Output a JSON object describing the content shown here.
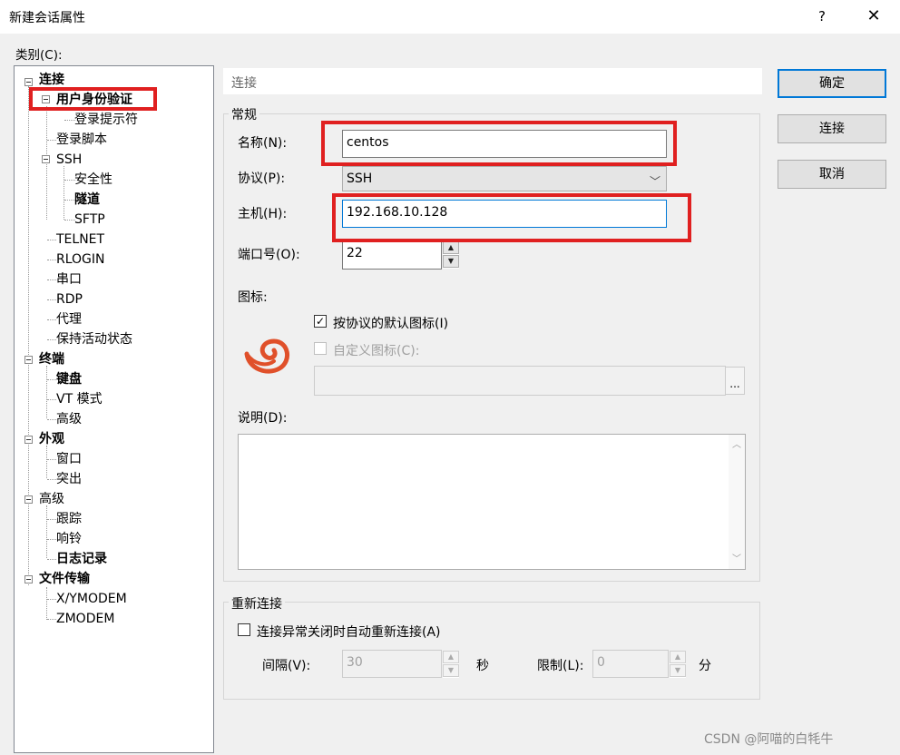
{
  "window": {
    "title": "新建会话属性",
    "help_label": "?",
    "close_label": "✕"
  },
  "category_label": "类别(C):",
  "tree": {
    "nodes": [
      {
        "label": "连接"
      },
      {
        "label": "用户身份验证"
      },
      {
        "label": "登录提示符"
      },
      {
        "label": "登录脚本"
      },
      {
        "label": "SSH"
      },
      {
        "label": "安全性"
      },
      {
        "label": "隧道"
      },
      {
        "label": "SFTP"
      },
      {
        "label": "TELNET"
      },
      {
        "label": "RLOGIN"
      },
      {
        "label": "串口"
      },
      {
        "label": "RDP"
      },
      {
        "label": "代理"
      },
      {
        "label": "保持活动状态"
      },
      {
        "label": "终端"
      },
      {
        "label": "键盘"
      },
      {
        "label": "VT 模式"
      },
      {
        "label": "高级"
      },
      {
        "label": "外观"
      },
      {
        "label": "窗口"
      },
      {
        "label": "突出"
      },
      {
        "label": "高级"
      },
      {
        "label": "跟踪"
      },
      {
        "label": "响铃"
      },
      {
        "label": "日志记录"
      },
      {
        "label": "文件传输"
      },
      {
        "label": "X/YMODEM"
      },
      {
        "label": "ZMODEM"
      }
    ]
  },
  "section_header": "连接",
  "general": {
    "group_title": "常规",
    "name_label": "名称(N):",
    "name_value": "centos",
    "protocol_label": "协议(P):",
    "protocol_value": "SSH",
    "host_label": "主机(H):",
    "host_value": "192.168.10.128",
    "port_label": "端口号(O):",
    "port_value": "22",
    "icon_label": "图标:",
    "default_icon_checkbox": "按协议的默认图标(I)",
    "custom_icon_checkbox": "自定义图标(C):",
    "browse_label": "...",
    "description_label": "说明(D):"
  },
  "reconnect": {
    "group_title": "重新连接",
    "auto_reconnect_checkbox": "连接异常关闭时自动重新连接(A)",
    "interval_label": "间隔(V):",
    "interval_value": "30",
    "interval_unit": "秒",
    "limit_label": "限制(L):",
    "limit_value": "0",
    "limit_unit": "分"
  },
  "buttons": {
    "ok": "确定",
    "connect": "连接",
    "cancel": "取消"
  },
  "checked_mark": "✓",
  "watermark": "CSDN @阿喵的白牦牛",
  "colors": {
    "highlight_box": "#e02020",
    "focus_border": "#0078d7",
    "app_icon": "#e0502a"
  }
}
